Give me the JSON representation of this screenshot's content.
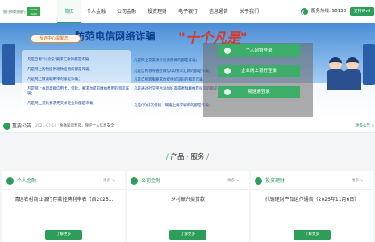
{
  "header": {
    "logo_text": "银川市商业银行",
    "logo_badge": "CIMBS BANK",
    "nav": [
      "首页",
      "个人金融",
      "公司金融",
      "投资理财",
      "电子银行",
      "信息通告",
      "关于我们"
    ],
    "active_nav": "首页",
    "hotline": "服务热线: 96138",
    "ipv6": "支持IPv6"
  },
  "banner": {
    "title": "防范电信网络诈骗",
    "slogan": "\"十个凡是\"",
    "tag": "反诈中心提醒您：",
    "left_bullets": [
      "凡是自称\"公检法\"要求汇款的都是诈骗；",
      "凡是网上购物提供退款赔偿的都是诈骗；",
      "凡是网上做兼职刷单的都是诈骗；",
      "凡是网上办理高额信用卡、贷款，要求你提前缴纳费用的都是诈骗；",
      "凡是网上贷款要求先交保证金的都是诈骗；"
    ],
    "right_bullets": [
      "凡是网上交友诱导投资赌博的都是诈骗；",
      "凡是自称领导通过微信QQ要求汇款的都是诈骗；",
      "凡是自称客服要求你提供验证码的都是诈骗；",
      "凡是通过社交平台添加好友或者群聊推荐投资的都是诈骗；",
      "凡是QQ好友借钱、网络上要求刷单的都是诈骗；"
    ]
  },
  "login": {
    "items": [
      "个人网银登录",
      "企业网上银行登录",
      "易速通登录"
    ]
  },
  "notice": {
    "label": "重要公告",
    "date": "2023-07-14",
    "text": "金融知识普及，保护个人信息安全",
    "more": "更多公告 >"
  },
  "products": {
    "title": "产品 · 服务",
    "more_label": "更多 >",
    "button_label": "了解更多",
    "cards": [
      {
        "title": "个人金融",
        "product": "清远农村商业银行存款挂牌利率表（自2025..."
      },
      {
        "title": "公司金融",
        "product": "乡村振兴类贷款"
      },
      {
        "title": "投资理财",
        "product": "代销理财产品运作通告（2025年11月6日）"
      }
    ]
  }
}
